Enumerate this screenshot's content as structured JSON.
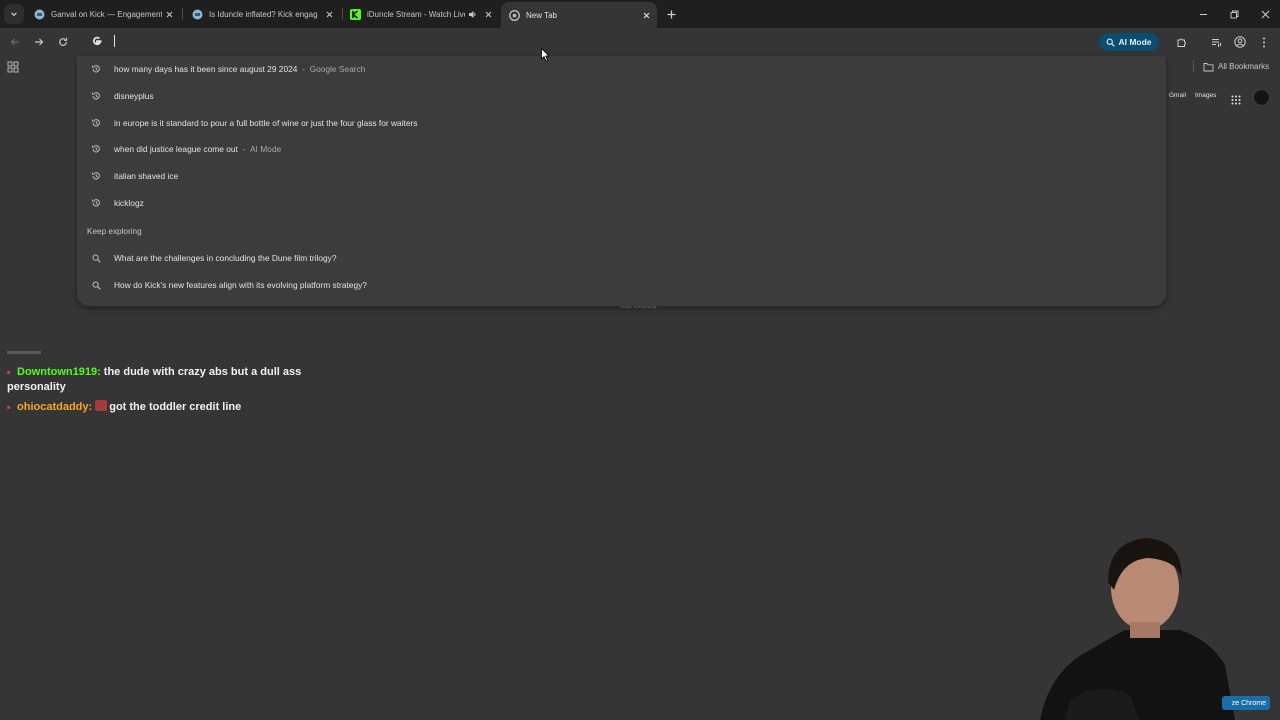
{
  "tabs": [
    {
      "title": "Ganval on Kick — Engagement",
      "favicon": "kick-analytics-icon"
    },
    {
      "title": "Is Iduncle inflated? Kick engag",
      "favicon": "kick-analytics-icon"
    },
    {
      "title": "iDuncle Stream - Watch Live",
      "favicon": "kick-logo-icon"
    },
    {
      "title": "New Tab",
      "favicon": "chrome-icon",
      "active": true
    }
  ],
  "toolbar": {
    "ai_mode_label": "AI Mode"
  },
  "bookmarks": {
    "all_bookmarks_label": "All Bookmarks"
  },
  "ntp": {
    "gmail_label": "Gmail",
    "images_label": "Images",
    "add_shortcut_label": "Add shortcut"
  },
  "dropdown": {
    "history": [
      {
        "text": "how many days has it been since august 29 2024",
        "suffix": "Google Search"
      },
      {
        "text": "disneyplus",
        "suffix": ""
      },
      {
        "text": "in europe is it standard to pour a full bottle of wine or just the four glass for waiters",
        "suffix": ""
      },
      {
        "text": "when did justice league come out",
        "suffix": "AI Mode"
      },
      {
        "text": "italian shaved ice",
        "suffix": ""
      },
      {
        "text": "kicklogz",
        "suffix": ""
      }
    ],
    "section_header": "Keep exploring",
    "explore": [
      {
        "text": "What are the challenges in concluding the Dune film trilogy?"
      },
      {
        "text": "How do Kick's new features align with its evolving platform strategy?"
      }
    ]
  },
  "chat": [
    {
      "user": "Downtown1919:",
      "message": "the dude with crazy abs but a dull ass",
      "message_cont": "personality",
      "color": "#53fc18"
    },
    {
      "user": "ohiocatdaddy:",
      "message": "got the toddler credit line",
      "color": "#f5a623"
    }
  ],
  "overlay": {
    "chrome_label": "ze Chrome"
  },
  "colors": {
    "frame": "#1f1f1f",
    "page": "#353535",
    "dropdown": "#3c3c3c",
    "ai_mode": "#0b4d6e"
  }
}
